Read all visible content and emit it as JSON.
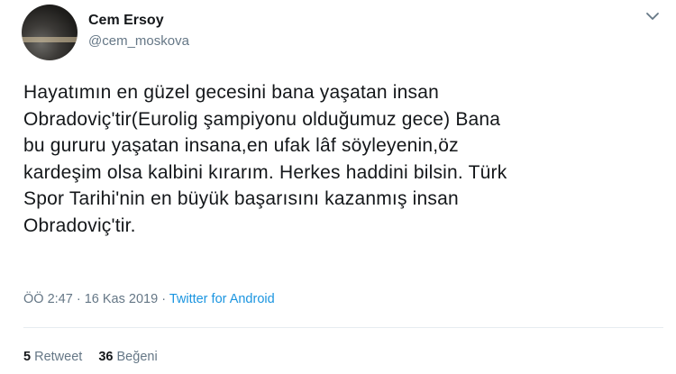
{
  "author": {
    "display_name": "Cem Ersoy",
    "handle": "@cem_moskova"
  },
  "tweet": {
    "text": "Hayatımın en güzel gecesini bana yaşatan insan\nObradoviç'tir(Eurolig şampiyonu olduğumuz gece) Bana\nbu gururu yaşatan insana,en ufak lâf söyleyenin,öz\nkardeşim olsa kalbini kırarım. Herkes haddini bilsin. Türk\nSpor Tarihi'nin en büyük başarısını kazanmış insan\nObradoviç'tir.",
    "time": "ÖÖ 2:47",
    "separator": "·",
    "date": "16 Kas 2019",
    "source": "Twitter for Android"
  },
  "stats": {
    "retweet_count": "5",
    "retweet_label": "Retweet",
    "like_count": "36",
    "like_label": "Beğeni"
  },
  "icons": {
    "menu": "chevron-down-icon"
  },
  "colors": {
    "text": "#14171a",
    "secondary": "#657786",
    "link": "#1b95e0"
  }
}
